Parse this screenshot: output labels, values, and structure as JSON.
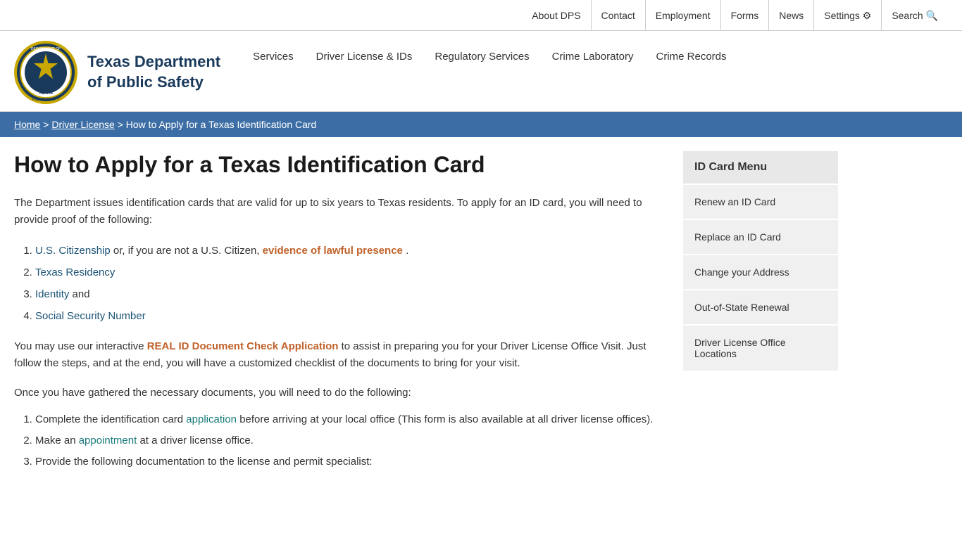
{
  "utility_bar": {
    "links": [
      {
        "label": "About DPS",
        "name": "about-dps-link"
      },
      {
        "label": "Contact",
        "name": "contact-link"
      },
      {
        "label": "Employment",
        "name": "employment-link"
      },
      {
        "label": "Forms",
        "name": "forms-link"
      },
      {
        "label": "News",
        "name": "news-link"
      },
      {
        "label": "Settings ⚙",
        "name": "settings-link"
      },
      {
        "label": "Search 🔍",
        "name": "search-link"
      }
    ]
  },
  "header": {
    "logo_text_line1": "Texas Department",
    "logo_text_line2": "of Public Safety",
    "nav_items": [
      {
        "label": "Services",
        "name": "nav-services"
      },
      {
        "label": "Driver License & IDs",
        "name": "nav-driver-license-ids"
      },
      {
        "label": "Regulatory Services",
        "name": "nav-regulatory-services"
      },
      {
        "label": "Crime Laboratory",
        "name": "nav-crime-laboratory"
      },
      {
        "label": "Crime Records",
        "name": "nav-crime-records"
      }
    ]
  },
  "breadcrumb": {
    "items": [
      {
        "label": "Home",
        "link": true
      },
      {
        "label": "Driver License",
        "link": true
      },
      {
        "label": "How to Apply for a Texas Identification Card",
        "link": false
      }
    ],
    "separator": ">"
  },
  "main": {
    "page_title": "How to Apply for a Texas Identification Card",
    "intro": "The Department issues identification cards that are valid for up to six years to Texas residents. To apply for an ID card, you will need to provide proof of the following:",
    "requirements": [
      {
        "text_before": "",
        "link_text": "U.S. Citizenship",
        "text_middle": " or, if you are not a U.S. Citizen, ",
        "link_text2": "evidence of lawful presence",
        "text_after": "."
      },
      {
        "text_before": "",
        "link_text": "Texas Residency",
        "text_middle": "",
        "link_text2": "",
        "text_after": ""
      },
      {
        "text_before": "",
        "link_text": "Identity",
        "text_middle": " and",
        "link_text2": "",
        "text_after": ""
      },
      {
        "text_before": "",
        "link_text": "Social Security Number",
        "text_middle": "",
        "link_text2": "",
        "text_after": ""
      }
    ],
    "real_id_para_before": "You may use our interactive ",
    "real_id_link": "REAL ID Document Check Application",
    "real_id_para_after": " to assist in preparing you for your Driver License Office Visit. Just follow the steps, and at the end, you will have a customized checklist of the documents to bring for your visit.",
    "gather_para": "Once you have gathered the necessary documents, you will need to do the following:",
    "steps": [
      {
        "text_before": "Complete the identification card ",
        "link_text": "application",
        "text_after": " before arriving at your local office (This form is also available at all driver license offices)."
      },
      {
        "text_before": "Make an ",
        "link_text": "appointment",
        "text_after": " at a driver license office."
      },
      {
        "text_before": "Provide the following documentation to the license and permit specialist:",
        "link_text": "",
        "text_after": ""
      }
    ]
  },
  "sidebar": {
    "menu_title": "ID Card Menu",
    "menu_items": [
      {
        "label": "Renew an ID Card",
        "name": "sidebar-renew-id"
      },
      {
        "label": "Replace an ID Card",
        "name": "sidebar-replace-id"
      },
      {
        "label": "Change your Address",
        "name": "sidebar-change-address"
      },
      {
        "label": "Out-of-State Renewal",
        "name": "sidebar-out-of-state"
      },
      {
        "label": "Driver License Office Locations",
        "name": "sidebar-office-locations"
      }
    ]
  }
}
